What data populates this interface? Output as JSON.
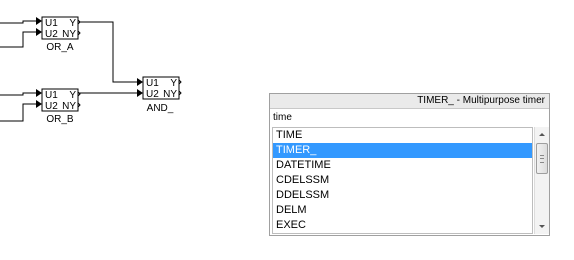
{
  "diagram": {
    "blocks": [
      {
        "id": "or_a",
        "input_1": "U1",
        "input_2": "U2",
        "output_1": "Y",
        "output_2": "NY",
        "name": "OR_A"
      },
      {
        "id": "or_b",
        "input_1": "U1",
        "input_2": "U2",
        "output_1": "Y",
        "output_2": "NY",
        "name": "OR_B"
      },
      {
        "id": "and",
        "input_1": "U1",
        "input_2": "U2",
        "output_1": "Y",
        "output_2": "NY",
        "name": "AND_"
      }
    ],
    "colors": {
      "line": "#000000",
      "block_border": "#000000",
      "background": "#ffffff"
    }
  },
  "autocomplete": {
    "header": "TIMER_ - Multipurpose timer",
    "input_value": "time",
    "items": [
      {
        "label": "TIME",
        "selected": false
      },
      {
        "label": "TIMER_",
        "selected": true
      },
      {
        "label": "DATETIME",
        "selected": false
      },
      {
        "label": "CDELSSM",
        "selected": false
      },
      {
        "label": "DDELSSM",
        "selected": false
      },
      {
        "label": "DELM",
        "selected": false
      },
      {
        "label": "EXEC",
        "selected": false
      }
    ],
    "colors": {
      "selection": "#3399ff",
      "selection_text": "#ffffff",
      "header_bg": "#eaeaea"
    }
  }
}
